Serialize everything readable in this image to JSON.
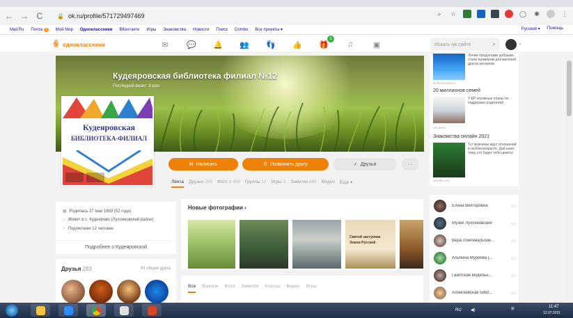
{
  "browser": {
    "back": "←",
    "forward": "→",
    "reload": "C",
    "url": "ok.ru/profile/571729497469",
    "lock": "🔒"
  },
  "bookmarks": {
    "items": [
      "Mail.Ru",
      "Почта",
      "Мой Мир",
      "Одноклассники",
      "ВКонтакте",
      "Игры",
      "Знакомства",
      "Новости",
      "Поиск",
      "Combo",
      "Все проекты ▾"
    ],
    "mail_badge": "0",
    "lang": "Русский ▾",
    "help": "Помощь"
  },
  "ok_header": {
    "logo_text": "одноклассники",
    "notif_count": "1",
    "search_placeholder": "Искать на сайте"
  },
  "cover": {
    "title": "Кудеяровская библиотека филиал №12",
    "last_visit": "Последний визит: 9 мая"
  },
  "avatar": {
    "line1": "Кудеяровская",
    "line2": "БИБЛИОТЕКА-ФИЛИАЛ"
  },
  "actions": {
    "write": "Написать",
    "invite": "Позвонить другу",
    "friends": "Друзья",
    "more": "···"
  },
  "profile_tabs": [
    {
      "label": "Лента",
      "count": ""
    },
    {
      "label": "Друзья",
      "count": "283"
    },
    {
      "label": "Фото",
      "count": "3 458"
    },
    {
      "label": "Группы",
      "count": "13"
    },
    {
      "label": "Игры",
      "count": "3"
    },
    {
      "label": "Заметки",
      "count": "886"
    },
    {
      "label": "Видео",
      "count": ""
    },
    {
      "label": "Ещё ▾",
      "count": ""
    }
  ],
  "info": {
    "born": "Родилась 27 мая 1969 (52 года)",
    "lives": "Живет в с. Кудеярово (Лухояновский район)",
    "subs": "Подписчики 12 человек",
    "more": "Подробнее о Кудеяровской"
  },
  "friends": {
    "title": "Друзья",
    "count": "283",
    "common": "43 общих друга"
  },
  "photos": {
    "title": "Новые фотографии ›",
    "p4_text1": "Святой заступник",
    "p4_text2": "Земли Русской"
  },
  "feed_tabs": [
    "Все",
    "Важное",
    "Фото",
    "Заметки",
    "Классы",
    "Видео",
    "Игры"
  ],
  "news": [
    {
      "title": "",
      "text": "Лечим продуктами добрыми стали примером для жителей других регионов",
      "src": "lechim-kozlov.ru"
    },
    {
      "title": "20 миллионов семей",
      "text": "У ЕР огромные планы по поддержке родителей",
      "src": "ura.news"
    },
    {
      "title": "Знакомства онлайн 2021",
      "text": "Тут мужчины ждут отношений в любом возрасте. Дай шанс тому, кто будет тебя ценить!",
      "src": "sbhalla.com"
    }
  ],
  "right_friends": [
    "Елена Викторовна",
    "Музей Лухояновский",
    "Вера Ломтева(Бозм...",
    "Альбина Муреева (...",
    "Газетская модельн...",
    "Алингеевская библ..."
  ],
  "taskbar": {
    "lang": "RU",
    "time": "11:47",
    "date": "12.07.2021"
  },
  "colors": {
    "ok_orange": "#ee8208",
    "notif_green": "#37b34a"
  }
}
